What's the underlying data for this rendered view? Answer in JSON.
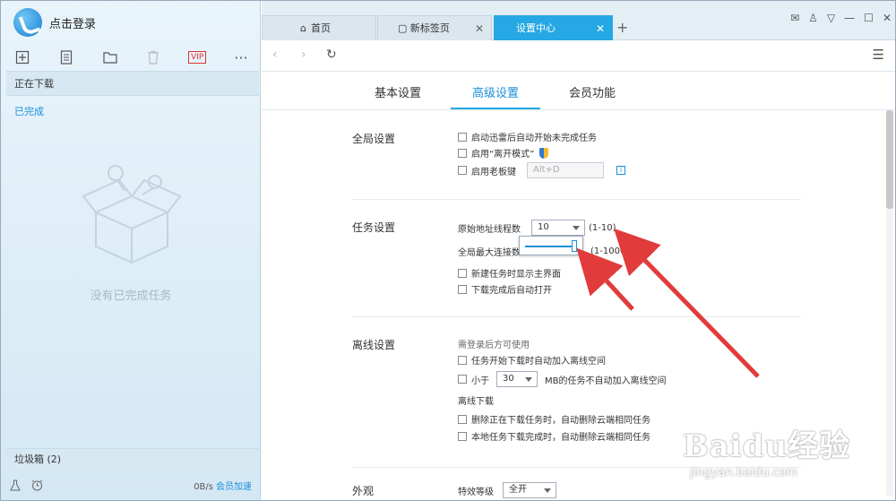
{
  "left": {
    "login": "点击登录",
    "vip": "VIP",
    "more": "···",
    "nav_downloading": "正在下载",
    "nav_done": "已完成",
    "empty_text": "没有已完成任务",
    "trash": "垃圾箱 (2)",
    "speed": "0B/s",
    "accelerate": "会员加速"
  },
  "tabs": {
    "home": "首页",
    "newtab": "新标签页",
    "settings": "设置中心",
    "close": "✕",
    "add": "+"
  },
  "subtabs": [
    "基本设置",
    "高级设置",
    "会员功能"
  ],
  "sections": {
    "global": {
      "title": "全局设置",
      "opt1": "启动迅雷后自动开始未完成任务",
      "opt2": "启用“离开模式”",
      "opt3": "启用老板键",
      "bosskey": "Alt+D"
    },
    "task": {
      "title": "任务设置",
      "threads_label": "原始地址线程数",
      "threads_value": "10",
      "threads_range": "(1-10)",
      "conn_label": "全局最大连接数",
      "conn_range": "(1-1000)",
      "opt1": "新建任务时显示主界面",
      "opt2": "下载完成后自动打开"
    },
    "offline": {
      "title": "离线设置",
      "hint": "需登录后方可使用",
      "opt1": "任务开始下载时自动加入离线空间",
      "opt2_prefix": "小于",
      "opt2_value": "30",
      "opt2_suffix": "MB的任务不自动加入离线空间",
      "sub_title": "离线下载",
      "opt3": "删除正在下载任务时，自动删除云端相同任务",
      "opt4": "本地任务下载完成时，自动删除云端相同任务"
    },
    "appearance": {
      "title": "外观",
      "effects_label": "特效等级",
      "effects_value": "全开"
    }
  },
  "watermark": {
    "big": "Baidu经验",
    "small": "jingyan.baidu.com"
  },
  "colors": {
    "accent": "#25a8e3",
    "arrow": "#e23b3b"
  }
}
